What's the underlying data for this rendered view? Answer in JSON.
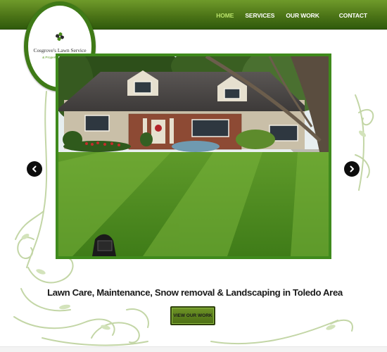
{
  "nav": {
    "items": [
      {
        "label": "HOME",
        "active": true
      },
      {
        "label": "SERVICES",
        "active": false
      },
      {
        "label": "OUR WORK",
        "active": false
      },
      {
        "label": "CONTACT",
        "active": false
      }
    ]
  },
  "logo": {
    "name": "Cosgrove's Lawn Service",
    "subtitle": "& Property Management"
  },
  "hero": {
    "tagline": "Lawn Care, Maintenance, Snow removal & Landscaping in Toledo Area",
    "cta_label": "VIEW OUR WORK"
  },
  "colors": {
    "nav_bar": "#4c7417",
    "nav_active": "#b9e26a",
    "slider_frame": "#3f8a1c",
    "logo_ring": "#3f7a17",
    "ornament": "#b9cf9a"
  },
  "icons": {
    "prev": "chevron-left-icon",
    "next": "chevron-right-icon"
  }
}
